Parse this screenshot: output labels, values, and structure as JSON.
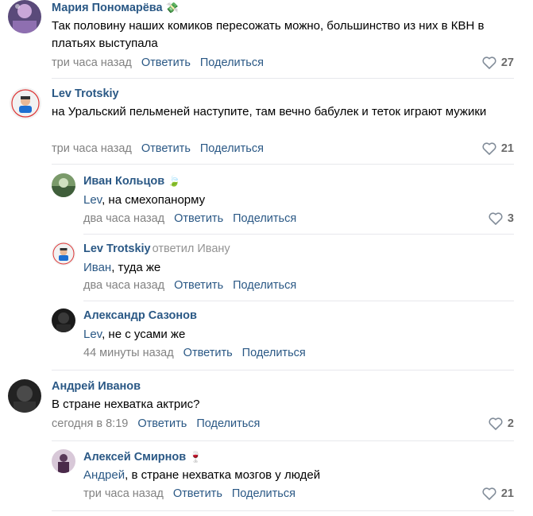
{
  "actions": {
    "reply": "Ответить",
    "share": "Поделиться"
  },
  "comments": [
    {
      "author": "Мария Пономарёва",
      "emoji": "💸",
      "text": "Так половину наших комиков пересожать можно, большинство из них в КВН в платьях выступала",
      "time": "три часа назад",
      "likes": "27"
    },
    {
      "author": "Lev Trotskiy",
      "text": "на Уральский пельменей наступите, там вечно бабулек и теток играют мужики",
      "time": "три часа назад",
      "likes": "21"
    },
    {
      "author": "Иван Кольцов",
      "emoji": "🍃",
      "mention": "Lev",
      "text": ", на смехопанорму",
      "time": "два часа назад",
      "likes": "3"
    },
    {
      "author": "Lev Trotskiy",
      "replied": "ответил Ивану",
      "mention": "Иван",
      "text": ", туда же",
      "time": "два часа назад"
    },
    {
      "author": "Александр Сазонов",
      "mention": "Lev",
      "text": ", не с усами же",
      "time": "44 минуты назад"
    },
    {
      "author": "Андрей Иванов",
      "text": "В стране нехватка актрис?",
      "time": "сегодня в 8:19",
      "likes": "2"
    },
    {
      "author": "Алексей Смирнов",
      "emoji": "🍷",
      "mention": "Андрей",
      "text": ", в стране нехватка мозгов у людей",
      "time": "три часа назад",
      "likes": "21"
    }
  ],
  "colors": {
    "link": "#2a5885",
    "meta": "#828282",
    "separator": "#e7e8ec"
  }
}
